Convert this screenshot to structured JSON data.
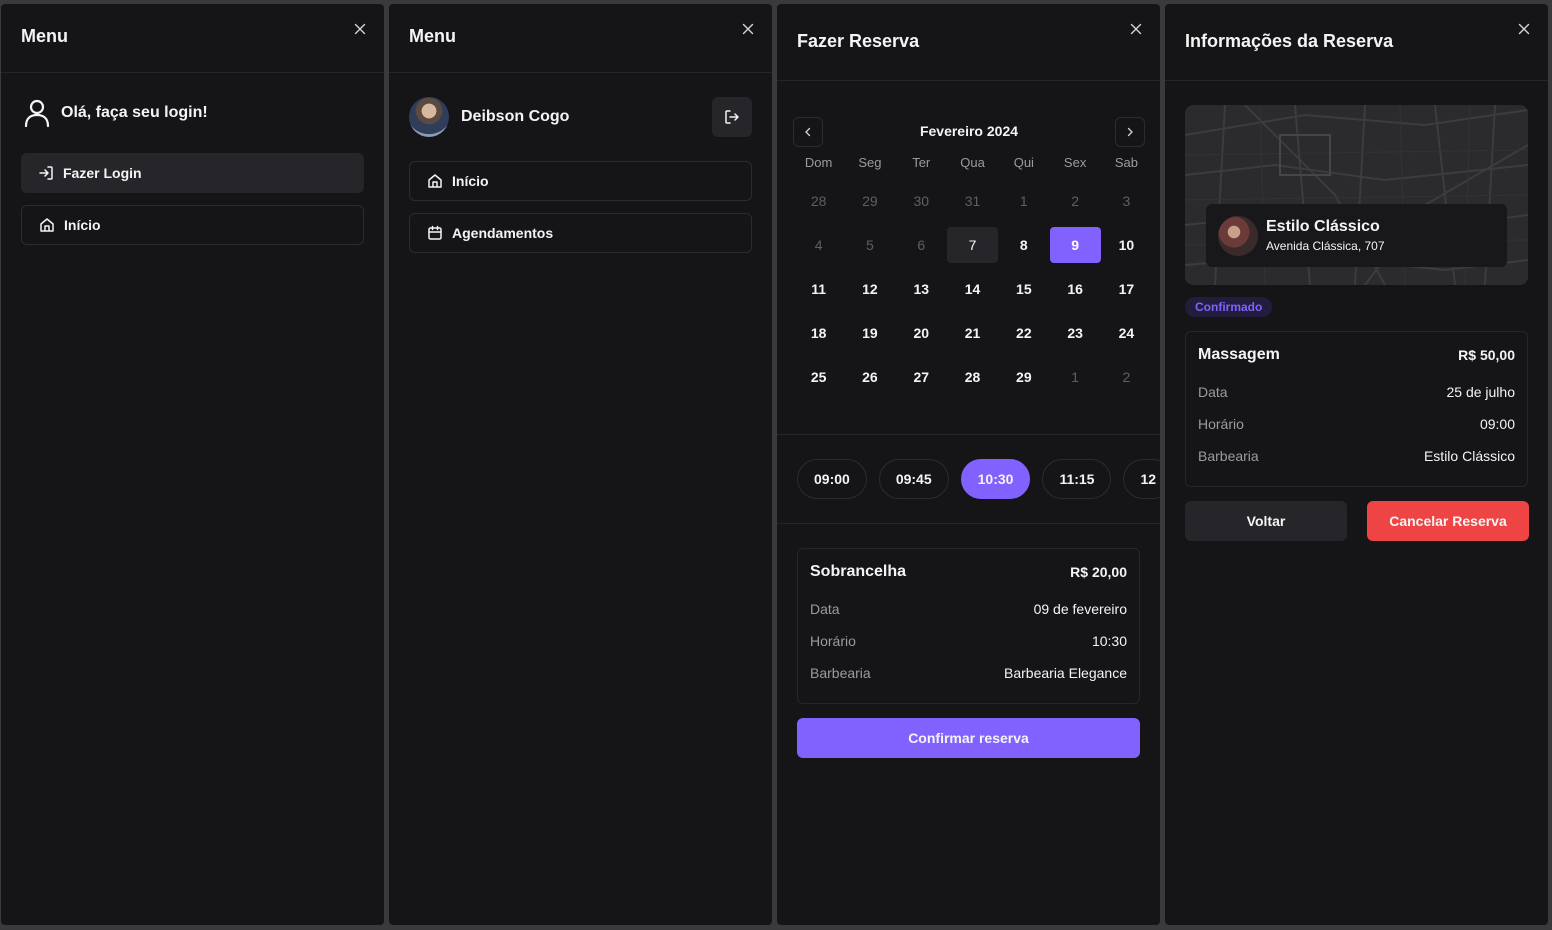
{
  "colors": {
    "background": "#151518",
    "accent": "#8162ff",
    "danger": "#ef4444",
    "muted": "#9a9aa2"
  },
  "panel1": {
    "title": "Menu",
    "close_icon": "close-icon",
    "greeting": "Olá, faça seu login!",
    "login_button": "Fazer Login",
    "home_button": "Início"
  },
  "panel2": {
    "title": "Menu",
    "user_name": "Deibson Cogo",
    "home_button": "Início",
    "bookings_button": "Agendamentos"
  },
  "panel3": {
    "title": "Fazer Reserva",
    "calendar": {
      "month": "Fevereiro 2024",
      "weekdays": [
        "Dom",
        "Seg",
        "Ter",
        "Qua",
        "Qui",
        "Sex",
        "Sab"
      ],
      "days": [
        {
          "n": "28",
          "s": "muted"
        },
        {
          "n": "29",
          "s": "muted"
        },
        {
          "n": "30",
          "s": "muted"
        },
        {
          "n": "31",
          "s": "muted"
        },
        {
          "n": "1",
          "s": "muted"
        },
        {
          "n": "2",
          "s": "muted"
        },
        {
          "n": "3",
          "s": "muted"
        },
        {
          "n": "4",
          "s": "muted"
        },
        {
          "n": "5",
          "s": "muted"
        },
        {
          "n": "6",
          "s": "muted"
        },
        {
          "n": "7",
          "s": "today"
        },
        {
          "n": "8",
          "s": "cur"
        },
        {
          "n": "9",
          "s": "sel"
        },
        {
          "n": "10",
          "s": "cur"
        },
        {
          "n": "11",
          "s": "cur"
        },
        {
          "n": "12",
          "s": "cur"
        },
        {
          "n": "13",
          "s": "cur"
        },
        {
          "n": "14",
          "s": "cur"
        },
        {
          "n": "15",
          "s": "cur"
        },
        {
          "n": "16",
          "s": "cur"
        },
        {
          "n": "17",
          "s": "cur"
        },
        {
          "n": "18",
          "s": "cur"
        },
        {
          "n": "19",
          "s": "cur"
        },
        {
          "n": "20",
          "s": "cur"
        },
        {
          "n": "21",
          "s": "cur"
        },
        {
          "n": "22",
          "s": "cur"
        },
        {
          "n": "23",
          "s": "cur"
        },
        {
          "n": "24",
          "s": "cur"
        },
        {
          "n": "25",
          "s": "cur"
        },
        {
          "n": "26",
          "s": "cur"
        },
        {
          "n": "27",
          "s": "cur"
        },
        {
          "n": "28",
          "s": "cur"
        },
        {
          "n": "29",
          "s": "cur"
        },
        {
          "n": "1",
          "s": "muted"
        },
        {
          "n": "2",
          "s": "muted"
        }
      ]
    },
    "times": [
      {
        "label": "09:00",
        "selected": false
      },
      {
        "label": "09:45",
        "selected": false
      },
      {
        "label": "10:30",
        "selected": true
      },
      {
        "label": "11:15",
        "selected": false
      },
      {
        "label": "12",
        "selected": false
      }
    ],
    "summary": {
      "service": "Sobrancelha",
      "price": "R$ 20,00",
      "rows": [
        {
          "k": "Data",
          "v": "09 de fevereiro"
        },
        {
          "k": "Horário",
          "v": "10:30"
        },
        {
          "k": "Barbearia",
          "v": "Barbearia Elegance"
        }
      ]
    },
    "confirm_button": "Confirmar reserva"
  },
  "panel4": {
    "title": "Informações da Reserva",
    "shop_name": "Estilo Clássico",
    "shop_address": "Avenida Clássica, 707",
    "status": "Confirmado",
    "summary": {
      "service": "Massagem",
      "price": "R$ 50,00",
      "rows": [
        {
          "k": "Data",
          "v": "25 de julho"
        },
        {
          "k": "Horário",
          "v": "09:00"
        },
        {
          "k": "Barbearia",
          "v": "Estilo Clássico"
        }
      ]
    },
    "back_button": "Voltar",
    "cancel_button": "Cancelar Reserva"
  }
}
